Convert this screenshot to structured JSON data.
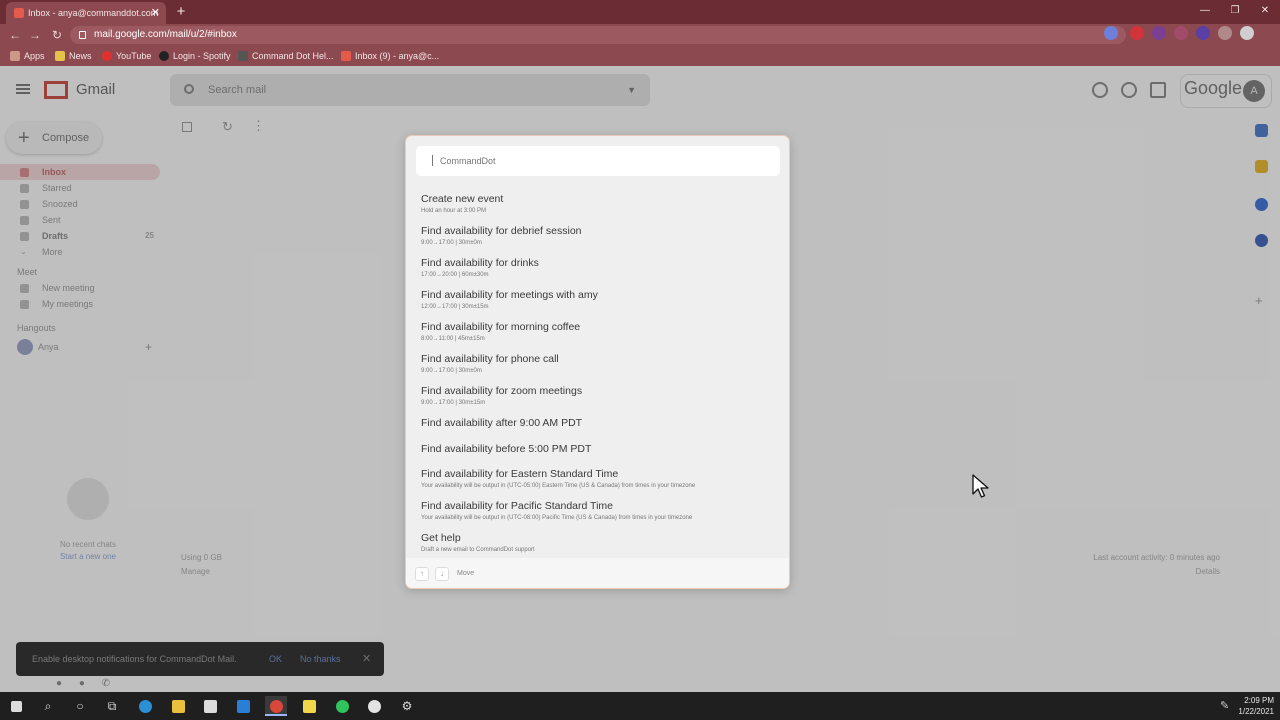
{
  "browser": {
    "tab_title": "Inbox - anya@commanddot.com",
    "url": "mail.google.com/mail/u/2/#inbox",
    "bookmarks": [
      "Apps",
      "News",
      "YouTube",
      "Login - Spotify",
      "Command Dot Hel...",
      "Inbox (9) - anya@c..."
    ]
  },
  "gmail": {
    "app_name": "Gmail",
    "search_placeholder": "Search mail",
    "compose_label": "Compose",
    "google_word": "Google",
    "avatar_letter": "A",
    "nav": [
      {
        "label": "Inbox",
        "count": ""
      },
      {
        "label": "Starred",
        "count": ""
      },
      {
        "label": "Snoozed",
        "count": ""
      },
      {
        "label": "Sent",
        "count": ""
      },
      {
        "label": "Drafts",
        "count": "25"
      },
      {
        "label": "More",
        "count": ""
      }
    ],
    "meet_title": "Meet",
    "meet_items": [
      "New meeting",
      "My meetings"
    ],
    "hangouts_title": "Hangouts",
    "hangouts_user": "Anya",
    "no_recent_chats": "No recent chats",
    "start_new": "Start a new one",
    "storage": "Using 0 GB",
    "manage": "Manage",
    "last_activity": "Last account activity: 0 minutes ago",
    "details": "Details",
    "toast": {
      "message": "Enable desktop notifications for CommandDot Mail.",
      "ok": "OK",
      "no_thanks": "No thanks"
    }
  },
  "commanddot": {
    "input_placeholder": "CommandDot",
    "commands": [
      {
        "title": "Create new event",
        "subtitle": "Hold an hour at 3:00 PM"
      },
      {
        "title": "Find availability for debrief session",
        "subtitle": "9:00→17:00 | 30m±0m"
      },
      {
        "title": "Find availability for drinks",
        "subtitle": "17:00→20:00 | 60m±30m"
      },
      {
        "title": "Find availability for meetings with amy",
        "subtitle": "12:00→17:00 | 30m±15m"
      },
      {
        "title": "Find availability for morning coffee",
        "subtitle": "8:00→11:00 | 45m±15m"
      },
      {
        "title": "Find availability for phone call",
        "subtitle": "9:00→17:00 | 30m±0m"
      },
      {
        "title": "Find availability for zoom meetings",
        "subtitle": "9:00→17:00 | 30m±15m"
      },
      {
        "title": "Find availability after 9:00 AM PDT",
        "subtitle": ""
      },
      {
        "title": "Find availability before 5:00 PM PDT",
        "subtitle": ""
      },
      {
        "title": "Find availability for Eastern Standard Time",
        "subtitle": "Your availability will be output in (UTC-05:00) Eastern Time (US & Canada) from times in your timezone"
      },
      {
        "title": "Find availability for Pacific Standard Time",
        "subtitle": "Your availability will be output in (UTC-08:00) Pacific Time (US & Canada) from times in your timezone"
      },
      {
        "title": "Get help",
        "subtitle": "Draft a new email to CommandDot support"
      }
    ],
    "footer_up": "↑",
    "footer_down": "↓",
    "footer_move": "Move"
  },
  "taskbar": {
    "time": "2:09 PM",
    "date": "1/22/2021"
  },
  "colors": {
    "browser_frame": "#6b2c33",
    "modal_bg": "#efefef",
    "modal_border": "#e7cbb7"
  }
}
